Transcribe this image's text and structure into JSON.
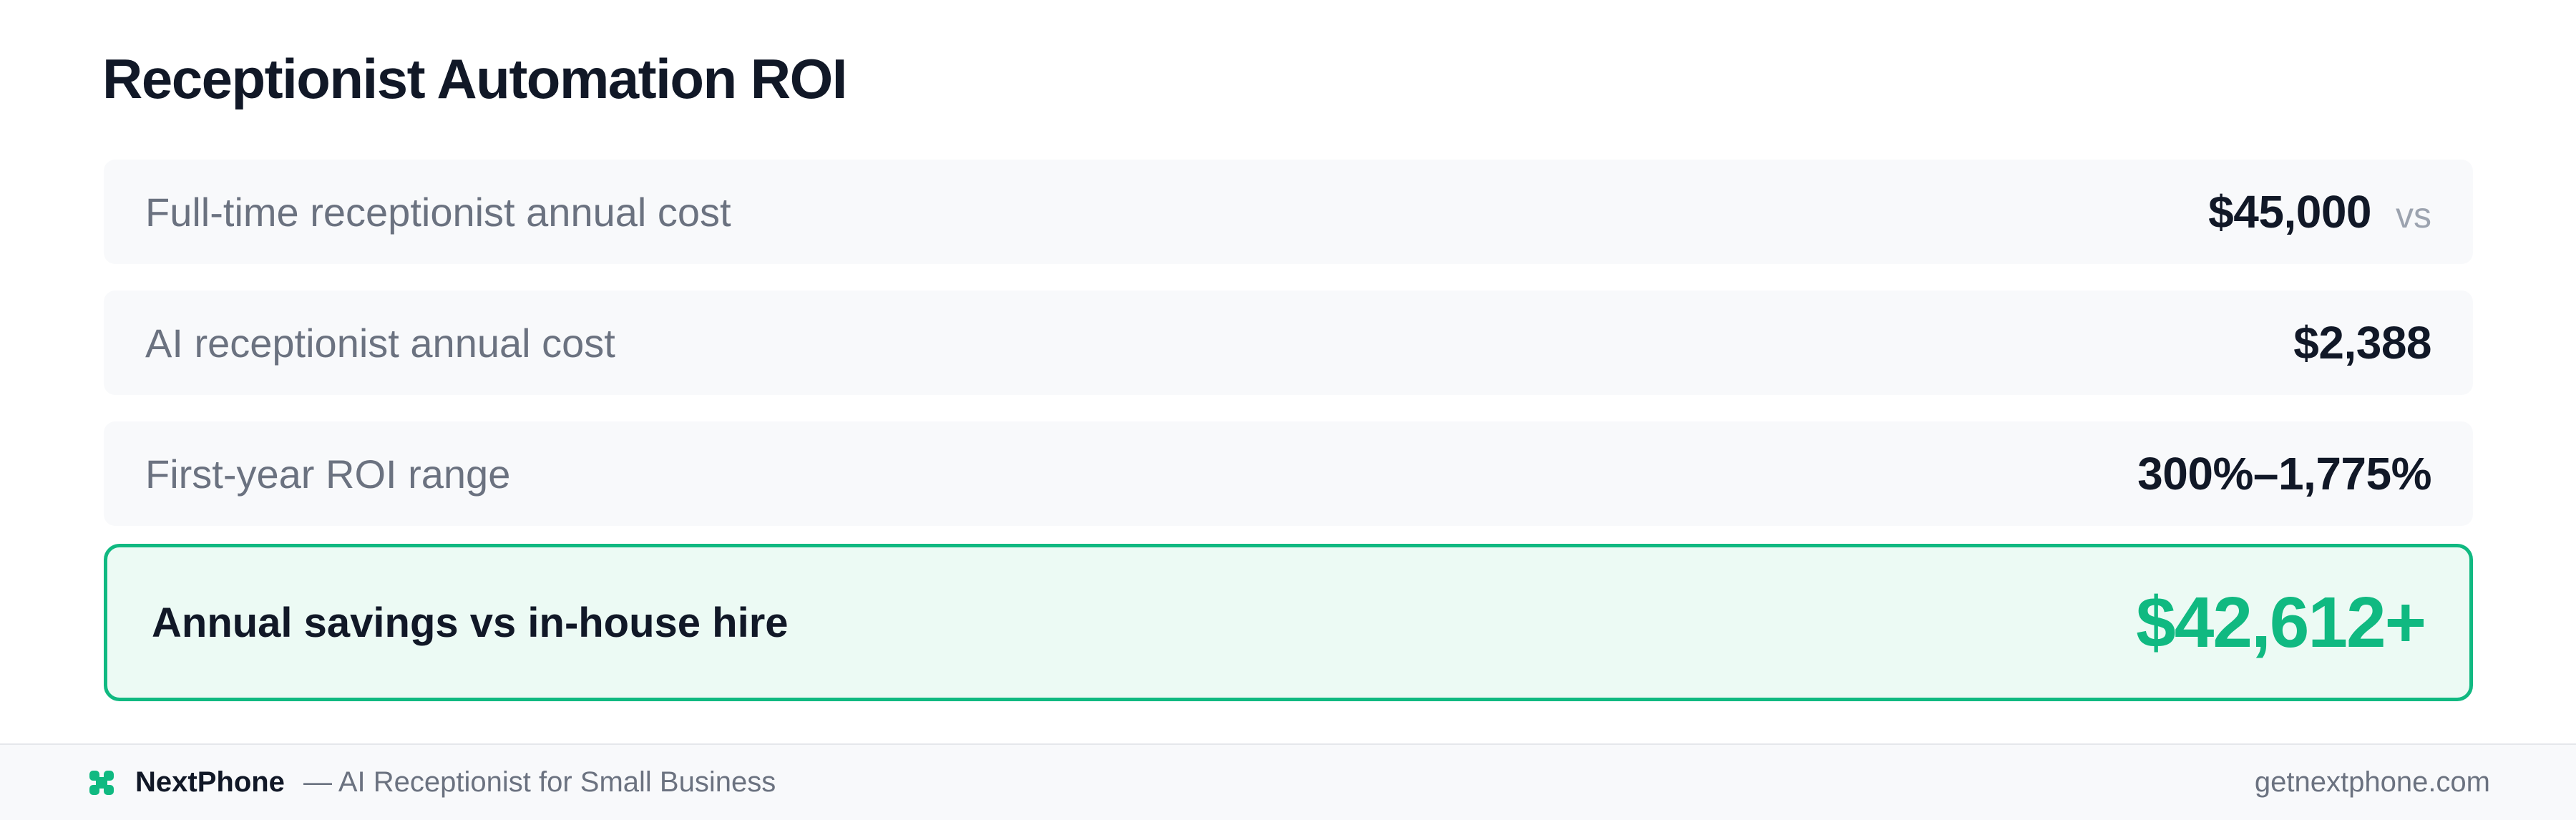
{
  "header": {
    "title": "Receptionist Automation ROI"
  },
  "rows": [
    {
      "label": "Full-time receptionist annual cost",
      "value": "$45,000",
      "suffix": "vs"
    },
    {
      "label": "AI receptionist annual cost",
      "value": "$2,388"
    },
    {
      "label": "First-year ROI range",
      "value": "300%–1,775%"
    }
  ],
  "highlight": {
    "label": "Annual savings vs in-house hire",
    "value": "$42,612+",
    "accent_color": "#10b981"
  },
  "footer": {
    "logo_icon": "nextphone-logo-icon",
    "brand": "NextPhone",
    "tagline": "— AI Receptionist for Small Business",
    "domain": "getnextphone.com"
  }
}
